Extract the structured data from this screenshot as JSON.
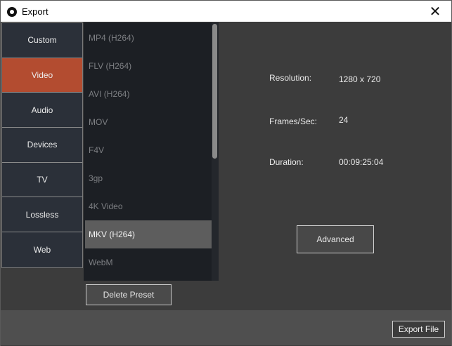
{
  "window": {
    "title": "Export",
    "close_glyph": "✕"
  },
  "sidebar": {
    "items": [
      {
        "label": "Custom",
        "active": false
      },
      {
        "label": "Video",
        "active": true
      },
      {
        "label": "Audio",
        "active": false
      },
      {
        "label": "Devices",
        "active": false
      },
      {
        "label": "TV",
        "active": false
      },
      {
        "label": "Lossless",
        "active": false
      },
      {
        "label": "Web",
        "active": false
      }
    ],
    "active_color": "#b34c30"
  },
  "formats": {
    "items": [
      {
        "label": "MP4 (H264)",
        "selected": false
      },
      {
        "label": "FLV (H264)",
        "selected": false
      },
      {
        "label": "AVI (H264)",
        "selected": false
      },
      {
        "label": "MOV",
        "selected": false
      },
      {
        "label": "F4V",
        "selected": false
      },
      {
        "label": "3gp",
        "selected": false
      },
      {
        "label": "4K Video",
        "selected": false
      },
      {
        "label": "MKV (H264)",
        "selected": true
      },
      {
        "label": "WebM",
        "selected": false
      }
    ],
    "delete_label": "Delete Preset"
  },
  "info": {
    "resolution_label": "Resolution:",
    "resolution_value": "1280 x 720",
    "fps_label": "Frames/Sec:",
    "fps_value": "24",
    "duration_label": "Duration:",
    "duration_value": "00:09:25:04"
  },
  "buttons": {
    "advanced": "Advanced",
    "export_file": "Export File"
  }
}
